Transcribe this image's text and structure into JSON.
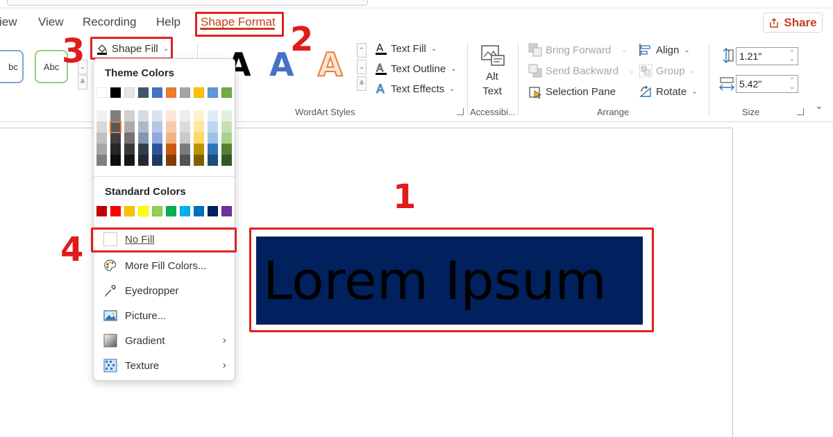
{
  "menu": {
    "tabs": [
      "iew",
      "View",
      "Recording",
      "Help",
      "Shape Format"
    ],
    "active_tab": "Shape Format",
    "share_label": "Share"
  },
  "ribbon": {
    "shape_styles": {
      "preview1": "bc",
      "preview2": "Abc"
    },
    "shape_fill_label": "Shape Fill",
    "wordart": {
      "letter": "A",
      "text_fill": "Text Fill",
      "text_outline": "Text Outline",
      "text_effects": "Text Effects",
      "group_label": "WordArt Styles"
    },
    "accessibility": {
      "alt_text_line1": "Alt",
      "alt_text_line2": "Text",
      "group_label": "Accessibi..."
    },
    "arrange": {
      "bring_forward": "Bring Forward",
      "send_backward": "Send Backward",
      "selection_pane": "Selection Pane",
      "align": "Align",
      "group": "Group",
      "rotate": "Rotate",
      "group_label": "Arrange"
    },
    "size": {
      "height": "1.21\"",
      "width": "5.42\"",
      "group_label": "Size"
    }
  },
  "dropdown": {
    "theme_colors_heading": "Theme Colors",
    "standard_colors_heading": "Standard Colors",
    "theme_colors": [
      "#ffffff",
      "#000000",
      "#e7e6e6",
      "#44546a",
      "#4472c4",
      "#ed7d31",
      "#a5a5a5",
      "#ffc000",
      "#5b9bd5",
      "#70ad47"
    ],
    "theme_tints": [
      [
        "#f2f2f2",
        "#d9d9d9",
        "#bfbfbf",
        "#a6a6a6",
        "#808080"
      ],
      [
        "#7f7f7f",
        "#595959",
        "#404040",
        "#262626",
        "#0d0d0d"
      ],
      [
        "#d0cece",
        "#aeaaaa",
        "#757171",
        "#3a3838",
        "#171616"
      ],
      [
        "#d6dce4",
        "#adb9ca",
        "#8497b0",
        "#333f4f",
        "#222a35"
      ],
      [
        "#dae3f3",
        "#b4c7e7",
        "#8faadc",
        "#2f5597",
        "#1f3864"
      ],
      [
        "#fbe5d6",
        "#f8cbad",
        "#f4b183",
        "#c55a11",
        "#843c0c"
      ],
      [
        "#ededed",
        "#dbdbdb",
        "#c9c9c9",
        "#7b7b7b",
        "#525252"
      ],
      [
        "#fff2cc",
        "#ffe699",
        "#ffd966",
        "#bf9000",
        "#7f6000"
      ],
      [
        "#deebf7",
        "#bdd7ee",
        "#9dc3e6",
        "#2e75b6",
        "#1f4e79"
      ],
      [
        "#e2f0d9",
        "#c5e0b4",
        "#a9d18e",
        "#548235",
        "#385723"
      ]
    ],
    "standard_colors": [
      "#c00000",
      "#ff0000",
      "#ffc000",
      "#ffff00",
      "#92d050",
      "#00b050",
      "#00b0f0",
      "#0070c0",
      "#002060",
      "#7030a0"
    ],
    "items": {
      "no_fill": "No Fill",
      "more_fill_colors": "More Fill Colors...",
      "eyedropper": "Eyedropper",
      "picture": "Picture...",
      "gradient": "Gradient",
      "texture": "Texture"
    }
  },
  "slide": {
    "textbox_text": "Lorem Ipsum",
    "textbox_fill": "#00215e"
  },
  "callouts": [
    "1",
    "2",
    "3",
    "4"
  ],
  "colors": {
    "accent": "#c43e1c",
    "annotation_red": "#e02020"
  }
}
